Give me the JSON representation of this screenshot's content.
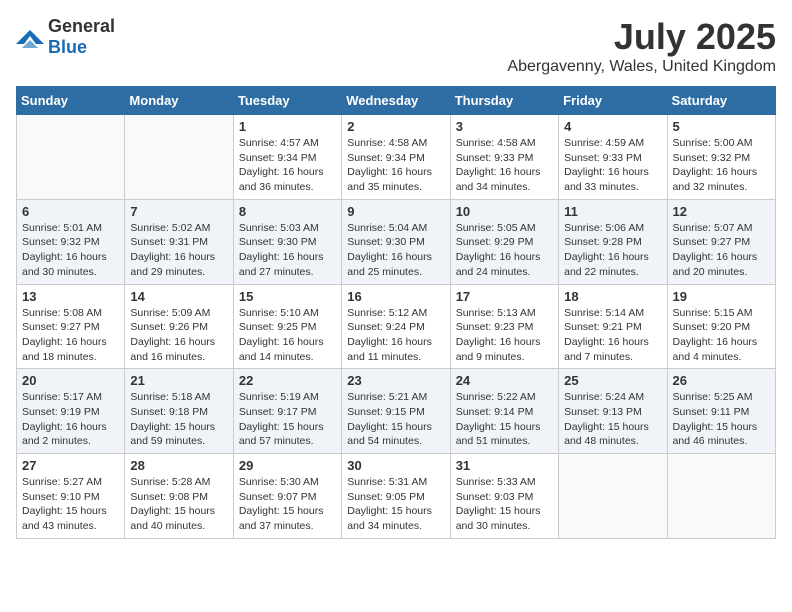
{
  "header": {
    "logo": {
      "general": "General",
      "blue": "Blue"
    },
    "title": "July 2025",
    "subtitle": "Abergavenny, Wales, United Kingdom"
  },
  "calendar": {
    "weekdays": [
      "Sunday",
      "Monday",
      "Tuesday",
      "Wednesday",
      "Thursday",
      "Friday",
      "Saturday"
    ],
    "weeks": [
      [
        {
          "day": "",
          "info": ""
        },
        {
          "day": "",
          "info": ""
        },
        {
          "day": "1",
          "sunrise": "Sunrise: 4:57 AM",
          "sunset": "Sunset: 9:34 PM",
          "daylight": "Daylight: 16 hours and 36 minutes."
        },
        {
          "day": "2",
          "sunrise": "Sunrise: 4:58 AM",
          "sunset": "Sunset: 9:34 PM",
          "daylight": "Daylight: 16 hours and 35 minutes."
        },
        {
          "day": "3",
          "sunrise": "Sunrise: 4:58 AM",
          "sunset": "Sunset: 9:33 PM",
          "daylight": "Daylight: 16 hours and 34 minutes."
        },
        {
          "day": "4",
          "sunrise": "Sunrise: 4:59 AM",
          "sunset": "Sunset: 9:33 PM",
          "daylight": "Daylight: 16 hours and 33 minutes."
        },
        {
          "day": "5",
          "sunrise": "Sunrise: 5:00 AM",
          "sunset": "Sunset: 9:32 PM",
          "daylight": "Daylight: 16 hours and 32 minutes."
        }
      ],
      [
        {
          "day": "6",
          "sunrise": "Sunrise: 5:01 AM",
          "sunset": "Sunset: 9:32 PM",
          "daylight": "Daylight: 16 hours and 30 minutes."
        },
        {
          "day": "7",
          "sunrise": "Sunrise: 5:02 AM",
          "sunset": "Sunset: 9:31 PM",
          "daylight": "Daylight: 16 hours and 29 minutes."
        },
        {
          "day": "8",
          "sunrise": "Sunrise: 5:03 AM",
          "sunset": "Sunset: 9:30 PM",
          "daylight": "Daylight: 16 hours and 27 minutes."
        },
        {
          "day": "9",
          "sunrise": "Sunrise: 5:04 AM",
          "sunset": "Sunset: 9:30 PM",
          "daylight": "Daylight: 16 hours and 25 minutes."
        },
        {
          "day": "10",
          "sunrise": "Sunrise: 5:05 AM",
          "sunset": "Sunset: 9:29 PM",
          "daylight": "Daylight: 16 hours and 24 minutes."
        },
        {
          "day": "11",
          "sunrise": "Sunrise: 5:06 AM",
          "sunset": "Sunset: 9:28 PM",
          "daylight": "Daylight: 16 hours and 22 minutes."
        },
        {
          "day": "12",
          "sunrise": "Sunrise: 5:07 AM",
          "sunset": "Sunset: 9:27 PM",
          "daylight": "Daylight: 16 hours and 20 minutes."
        }
      ],
      [
        {
          "day": "13",
          "sunrise": "Sunrise: 5:08 AM",
          "sunset": "Sunset: 9:27 PM",
          "daylight": "Daylight: 16 hours and 18 minutes."
        },
        {
          "day": "14",
          "sunrise": "Sunrise: 5:09 AM",
          "sunset": "Sunset: 9:26 PM",
          "daylight": "Daylight: 16 hours and 16 minutes."
        },
        {
          "day": "15",
          "sunrise": "Sunrise: 5:10 AM",
          "sunset": "Sunset: 9:25 PM",
          "daylight": "Daylight: 16 hours and 14 minutes."
        },
        {
          "day": "16",
          "sunrise": "Sunrise: 5:12 AM",
          "sunset": "Sunset: 9:24 PM",
          "daylight": "Daylight: 16 hours and 11 minutes."
        },
        {
          "day": "17",
          "sunrise": "Sunrise: 5:13 AM",
          "sunset": "Sunset: 9:23 PM",
          "daylight": "Daylight: 16 hours and 9 minutes."
        },
        {
          "day": "18",
          "sunrise": "Sunrise: 5:14 AM",
          "sunset": "Sunset: 9:21 PM",
          "daylight": "Daylight: 16 hours and 7 minutes."
        },
        {
          "day": "19",
          "sunrise": "Sunrise: 5:15 AM",
          "sunset": "Sunset: 9:20 PM",
          "daylight": "Daylight: 16 hours and 4 minutes."
        }
      ],
      [
        {
          "day": "20",
          "sunrise": "Sunrise: 5:17 AM",
          "sunset": "Sunset: 9:19 PM",
          "daylight": "Daylight: 16 hours and 2 minutes."
        },
        {
          "day": "21",
          "sunrise": "Sunrise: 5:18 AM",
          "sunset": "Sunset: 9:18 PM",
          "daylight": "Daylight: 15 hours and 59 minutes."
        },
        {
          "day": "22",
          "sunrise": "Sunrise: 5:19 AM",
          "sunset": "Sunset: 9:17 PM",
          "daylight": "Daylight: 15 hours and 57 minutes."
        },
        {
          "day": "23",
          "sunrise": "Sunrise: 5:21 AM",
          "sunset": "Sunset: 9:15 PM",
          "daylight": "Daylight: 15 hours and 54 minutes."
        },
        {
          "day": "24",
          "sunrise": "Sunrise: 5:22 AM",
          "sunset": "Sunset: 9:14 PM",
          "daylight": "Daylight: 15 hours and 51 minutes."
        },
        {
          "day": "25",
          "sunrise": "Sunrise: 5:24 AM",
          "sunset": "Sunset: 9:13 PM",
          "daylight": "Daylight: 15 hours and 48 minutes."
        },
        {
          "day": "26",
          "sunrise": "Sunrise: 5:25 AM",
          "sunset": "Sunset: 9:11 PM",
          "daylight": "Daylight: 15 hours and 46 minutes."
        }
      ],
      [
        {
          "day": "27",
          "sunrise": "Sunrise: 5:27 AM",
          "sunset": "Sunset: 9:10 PM",
          "daylight": "Daylight: 15 hours and 43 minutes."
        },
        {
          "day": "28",
          "sunrise": "Sunrise: 5:28 AM",
          "sunset": "Sunset: 9:08 PM",
          "daylight": "Daylight: 15 hours and 40 minutes."
        },
        {
          "day": "29",
          "sunrise": "Sunrise: 5:30 AM",
          "sunset": "Sunset: 9:07 PM",
          "daylight": "Daylight: 15 hours and 37 minutes."
        },
        {
          "day": "30",
          "sunrise": "Sunrise: 5:31 AM",
          "sunset": "Sunset: 9:05 PM",
          "daylight": "Daylight: 15 hours and 34 minutes."
        },
        {
          "day": "31",
          "sunrise": "Sunrise: 5:33 AM",
          "sunset": "Sunset: 9:03 PM",
          "daylight": "Daylight: 15 hours and 30 minutes."
        },
        {
          "day": "",
          "info": ""
        },
        {
          "day": "",
          "info": ""
        }
      ]
    ]
  }
}
